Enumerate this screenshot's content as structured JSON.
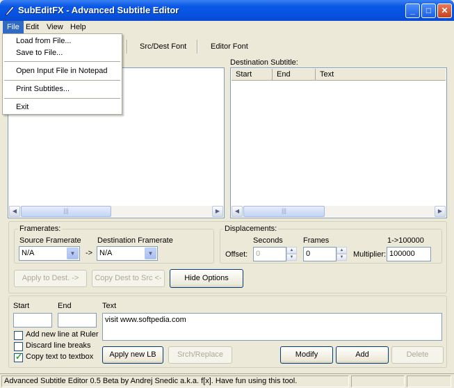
{
  "window": {
    "title": "SubEditFX - Advanced Subtitle Editor",
    "minimize_glyph": "_",
    "maximize_glyph": "□",
    "close_glyph": "✕"
  },
  "menubar": {
    "file": "File",
    "edit": "Edit",
    "view": "View",
    "help": "Help"
  },
  "file_menu": {
    "load": "Load from File...",
    "save": "Save to File...",
    "open_notepad": "Open Input File in Notepad",
    "print": "Print Subtitles...",
    "exit": "Exit"
  },
  "toolbar": {
    "src_dest_font": "Src/Dest Font",
    "editor_font": "Editor Font"
  },
  "destination": {
    "label": "Destination Subtitle:",
    "columns": [
      "Start",
      "End",
      "Text"
    ]
  },
  "framerates": {
    "group_title": "Framerates:",
    "source_label": "Source Framerate",
    "source_value": "N/A",
    "arrow": "->",
    "dest_label": "Destination Framerate",
    "dest_value": "N/A"
  },
  "displacements": {
    "group_title": "Displacements:",
    "seconds_label": "Seconds",
    "frames_label": "Frames",
    "range_label": "1->100000",
    "offset_label": "Offset:",
    "seconds_value": "0",
    "frames_value": "0",
    "multiplier_label": "Multiplier:",
    "multiplier_value": "100000"
  },
  "buttons": {
    "apply_to_dest": "Apply to Dest. ->",
    "copy_dest_to_src": "Copy Dest to Src <-",
    "hide_options": "Hide Options",
    "apply_new_lb": "Apply new LB",
    "srch_replace": "Srch/Replace",
    "modify": "Modify",
    "add": "Add",
    "delete": "Delete"
  },
  "editor": {
    "start_label": "Start",
    "end_label": "End",
    "text_label": "Text",
    "text_value": "visit www.softpedia.com",
    "add_new_line": "Add new line at Ruler",
    "discard_line_breaks": "Discard line breaks",
    "copy_text": "Copy text to textbox",
    "add_new_line_checked": false,
    "discard_checked": false,
    "copy_text_checked": true
  },
  "statusbar": {
    "text": "Advanced Subtitle Editor 0.5 Beta by Andrej Snedic a.k.a. f[x]. Have fun using this tool."
  },
  "scrollbar": {
    "left_arrow": "◀",
    "right_arrow": "▶",
    "grip": "|||"
  }
}
